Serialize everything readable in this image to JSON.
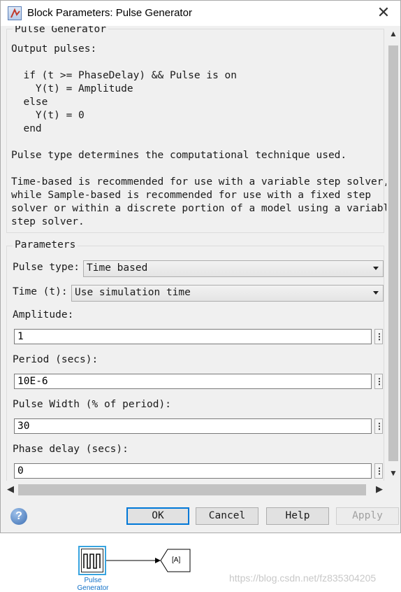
{
  "window": {
    "title": "Block Parameters: Pulse Generator",
    "close_glyph": "✕"
  },
  "description": {
    "group_title": "Pulse Generator",
    "lines": [
      "Output pulses:",
      "",
      "  if (t >= PhaseDelay) && Pulse is on",
      "    Y(t) = Amplitude",
      "  else",
      "    Y(t) = 0",
      "  end",
      "",
      "Pulse type determines the computational technique used.",
      "",
      "Time-based is recommended for use with a variable step solver,",
      "while Sample-based is recommended for use with a fixed step",
      "solver or within a discrete portion of a model using a variable",
      "step solver."
    ]
  },
  "parameters": {
    "group_title": "Parameters",
    "pulse_type": {
      "label": "Pulse type:",
      "value": "Time based"
    },
    "time": {
      "label": "Time (t):",
      "value": "Use simulation time"
    },
    "amplitude": {
      "label": "Amplitude:",
      "value": "1"
    },
    "period": {
      "label": "Period (secs):",
      "value": "10E-6"
    },
    "pulse_width": {
      "label": "Pulse Width (% of period):",
      "value": "30"
    },
    "phase_delay": {
      "label": "Phase delay (secs):",
      "value": "0"
    },
    "dots_glyph": "⋮"
  },
  "buttons": {
    "ok": "OK",
    "cancel": "Cancel",
    "help": "Help",
    "apply": "Apply",
    "help_icon": "?"
  },
  "model": {
    "block_label_line1": "Pulse",
    "block_label_line2": "Generator",
    "goto_tag": "[A]",
    "watermark": "https://blog.csdn.net/fz835304205"
  },
  "colors": {
    "accent": "#0078d7",
    "block_highlight": "#38a4e0",
    "block_label": "#1170c7"
  }
}
